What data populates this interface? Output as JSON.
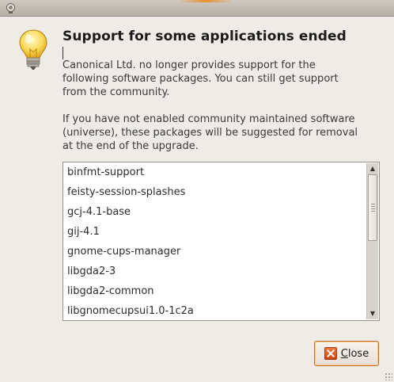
{
  "window": {
    "heading": "Support for some applications ended"
  },
  "message": {
    "paragraph1": "Canonical Ltd. no longer provides support for the following software packages. You can still get support from the community.",
    "paragraph2": "If you have not enabled community maintained software (universe), these packages will be suggested for removal at the end of the upgrade."
  },
  "packages": [
    "binfmt-support",
    "feisty-session-splashes",
    "gcj-4.1-base",
    "gij-4.1",
    "gnome-cups-manager",
    "libgda2-3",
    "libgda2-common",
    "libgnomecupsui1.0-1c2a"
  ],
  "buttons": {
    "close_mnemonic": "C",
    "close_rest": "lose"
  },
  "icons": {
    "title": "update-manager-icon",
    "dialog": "lightbulb-icon",
    "close": "close-icon"
  },
  "colors": {
    "dialog_bg": "#efebe7",
    "button_focus": "#c46f22"
  }
}
